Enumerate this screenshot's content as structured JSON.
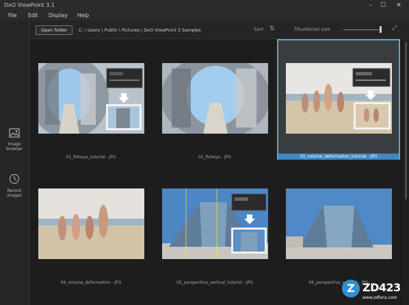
{
  "window": {
    "title": "DxO ViewPoint 3.1",
    "minimize": "–",
    "maximize": "☐",
    "close": "✕"
  },
  "menu": {
    "items": [
      "File",
      "Edit",
      "Display",
      "Help"
    ]
  },
  "sidebar": {
    "image_browser": [
      "Image",
      "browser"
    ],
    "recent_images": [
      "Recent",
      "images"
    ]
  },
  "toolbar": {
    "open_folder": "Open folder",
    "path": "C: \\ Users \\ Public \\ Pictures \\ DxO ViewPoint 3 Samples",
    "sort": "Sort",
    "sort_icon": "sort-icon",
    "thumbnail_size": "Thumbnail size",
    "thumbnail_size_level": 0.97,
    "fullscreen_icon": "expand-icon"
  },
  "thumbnails": [
    {
      "caption": "01_fisheye_tutorial - JPG",
      "selected": false
    },
    {
      "caption": "02_fisheye - JPG",
      "selected": false
    },
    {
      "caption": "03_volume_deformation_tutorial - JPG",
      "selected": true
    },
    {
      "caption": "04_volume_deformation - JPG",
      "selected": false
    },
    {
      "caption": "05_perspective_vertical_tutorial - JPG",
      "selected": false
    },
    {
      "caption": "06_perspective_vertical - JPG",
      "selected": false
    }
  ],
  "watermark": {
    "badge": "Z",
    "brand": "ZD423",
    "url": "www.zdfans.com"
  },
  "colors": {
    "accent": "#5aa7d6",
    "selection_caption": "#3e88c4",
    "background": "#1d1d1d"
  }
}
